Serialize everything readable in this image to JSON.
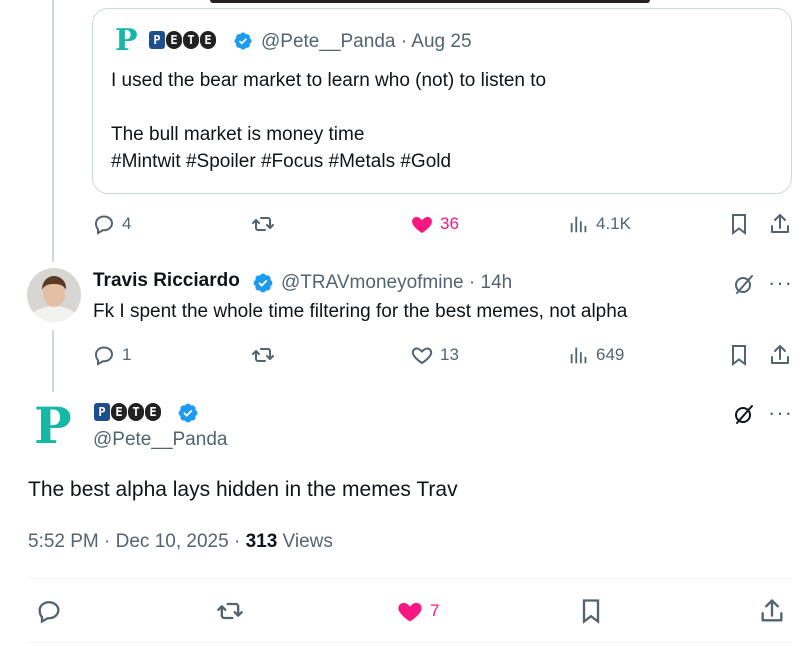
{
  "quoted": {
    "handle": "@Pete__Panda",
    "date": "Aug 25",
    "line1": "I used the bear market to learn who (not) to listen to",
    "line2": "The bull market is money time",
    "line3": "#Mintwit #Spoiler #Focus #Metals #Gold",
    "badge": [
      "P",
      "E",
      "T",
      "E"
    ]
  },
  "post1_stats": {
    "replies": "4",
    "likes": "36",
    "views": "4.1K"
  },
  "reply": {
    "name": "Travis Ricciardo",
    "handle": "@TRAVmoneyofmine",
    "time": "14h",
    "text": "Fk I spent the whole time filtering for the best memes, not alpha",
    "stats": {
      "replies": "1",
      "likes": "13",
      "views": "649"
    }
  },
  "main": {
    "handle": "@Pete__Panda",
    "badge": [
      "P",
      "E",
      "T",
      "E"
    ],
    "text": "The best alpha lays hidden in the memes Trav",
    "timestamp": "5:52 PM · Dec 10, 2025 ·",
    "views_count": "313",
    "views_label": "Views",
    "likes": "7"
  },
  "colors": {
    "like": "#f91880",
    "verified": "#1d9bf0",
    "muted": "#536471",
    "logo": "#15b8a6"
  }
}
